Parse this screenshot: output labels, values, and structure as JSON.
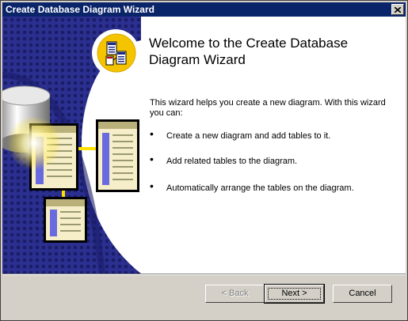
{
  "window": {
    "title": "Create Database Diagram Wizard"
  },
  "icons": {
    "close": "close-icon",
    "welcome": "database-diagram-icon",
    "illustration": "database-tables-illustration"
  },
  "content": {
    "heading": "Welcome to the Create Database Diagram Wizard",
    "intro": "This wizard helps you create a new diagram. With this wizard you can:",
    "bullets": [
      "Create a new diagram and add tables to it.",
      "Add related tables to the diagram.",
      "Automatically arrange the tables on the diagram."
    ]
  },
  "buttons": {
    "back": "< Back",
    "next": "Next >",
    "cancel": "Cancel"
  },
  "colors": {
    "titlebar": "#0a246a",
    "art_background": "#2a2e8c",
    "icon_circle": "#f5c400"
  }
}
